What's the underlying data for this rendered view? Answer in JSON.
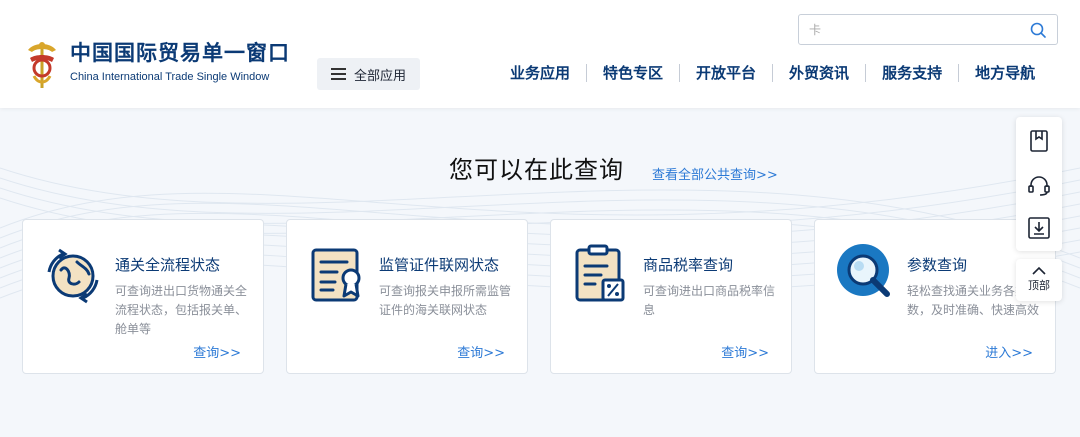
{
  "header": {
    "logo_cn": "中国国际贸易单一窗口",
    "logo_en": "China International Trade Single Window",
    "all_apps_label": "全部应用",
    "search_placeholder": "卡",
    "nav": [
      "业务应用",
      "特色专区",
      "开放平台",
      "外贸资讯",
      "服务支持",
      "地方导航"
    ]
  },
  "main": {
    "title": "您可以在此查询",
    "view_all_link": "查看全部公共查询>>",
    "cards": [
      {
        "icon": "customs-cycle-icon",
        "title": "通关全流程状态",
        "desc": "可查询进出口货物通关全流程状态，包括报关单、舱单等",
        "link": "查询>>"
      },
      {
        "icon": "certificate-icon",
        "title": "监管证件联网状态",
        "desc": "可查询报关申报所需监管证件的海关联网状态",
        "link": "查询>>"
      },
      {
        "icon": "tax-rate-icon",
        "title": "商品税率查询",
        "desc": "可查询进出口商品税率信息",
        "link": "查询>>"
      },
      {
        "icon": "magnifier-icon",
        "title": "参数查询",
        "desc": "轻松查找通关业务各类参数，及时准确、快速高效",
        "link": "进入>>"
      }
    ]
  },
  "float_bar": {
    "items": [
      "bookmark-icon",
      "headset-icon",
      "download-icon"
    ],
    "top_label": "顶部"
  },
  "colors": {
    "brand": "#0b3a75",
    "link": "#2d7ad6",
    "accent_orange": "#f3a23a"
  }
}
